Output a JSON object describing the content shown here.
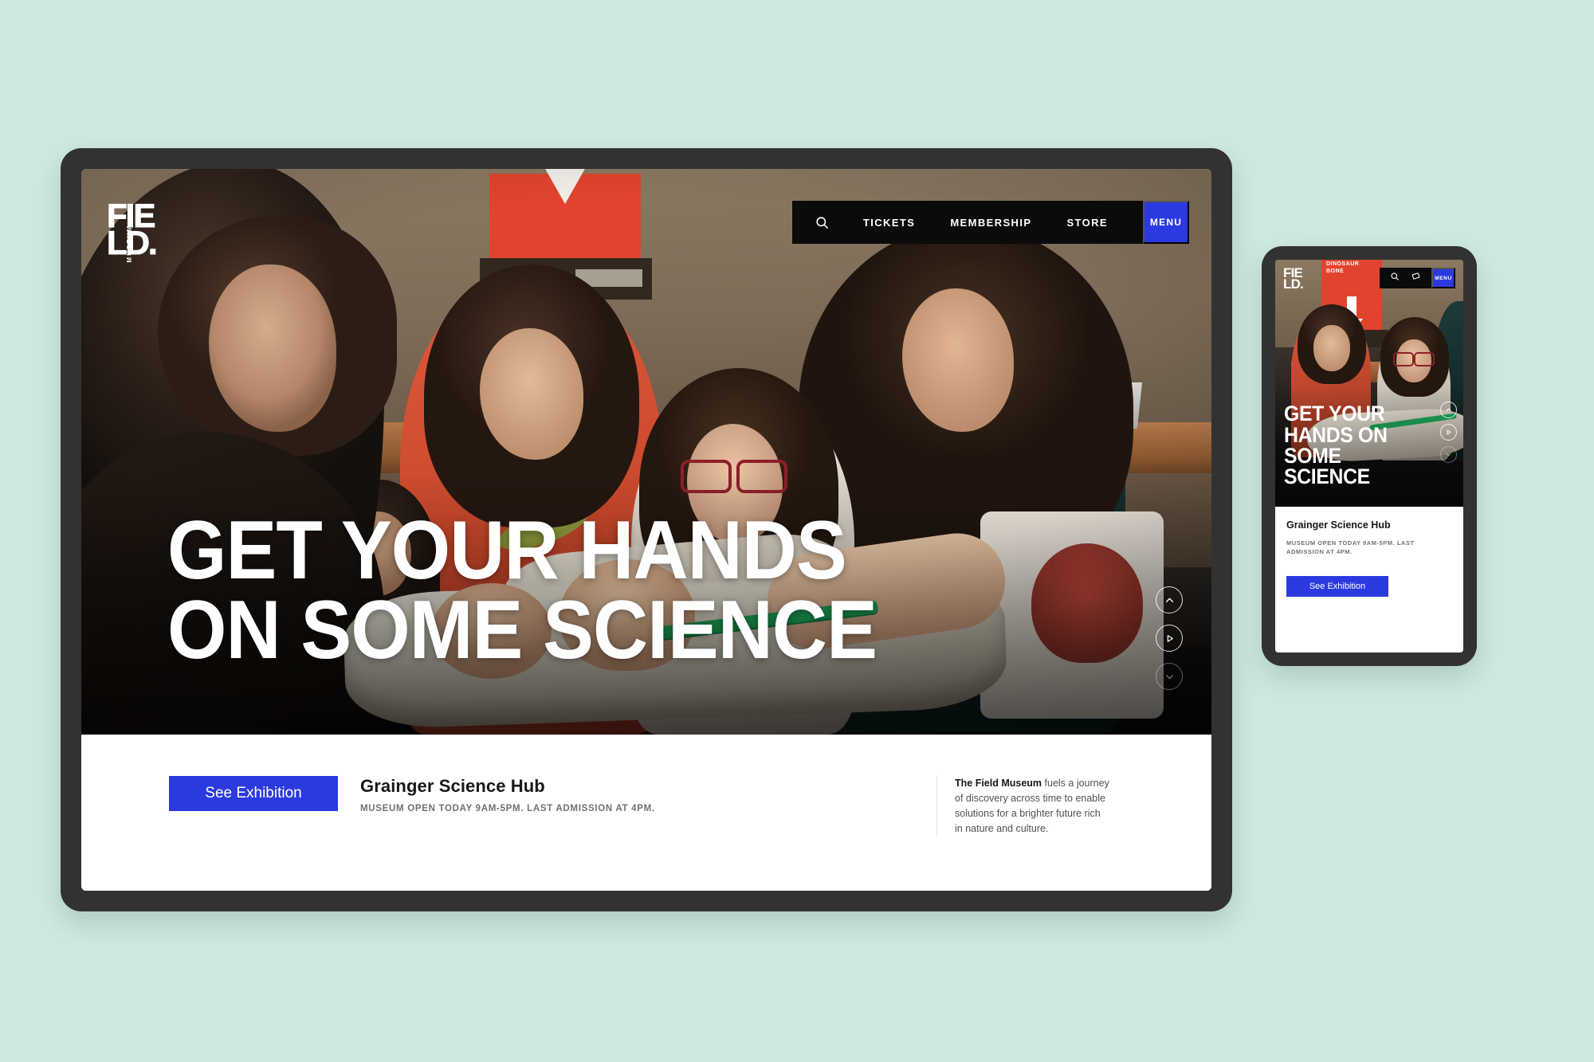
{
  "page": {
    "background_color": "#cfe9df",
    "accent_blue": "#2b3ae0",
    "frame_color": "#323232"
  },
  "brand": {
    "logo_line1": "FIE",
    "logo_line2": "LD.",
    "logo_vertical": "MUSEUM"
  },
  "desktop": {
    "nav": {
      "search_icon": "search-icon",
      "items": [
        {
          "label": "TICKETS"
        },
        {
          "label": "MEMBERSHIP"
        },
        {
          "label": "STORE"
        }
      ],
      "menu_label": "MENU"
    },
    "hero": {
      "headline": "GET YOUR HANDS ON SOME SCIENCE",
      "controls": [
        {
          "name": "chevron-up-icon",
          "state": "active"
        },
        {
          "name": "play-icon",
          "state": "active"
        },
        {
          "name": "chevron-down-icon",
          "state": "dimmed"
        }
      ]
    },
    "info": {
      "cta_label": "See Exhibition",
      "title": "Grainger Science Hub",
      "hours": "MUSEUM OPEN TODAY 9AM-5PM. LAST ADMISSION AT 4PM.",
      "mission_bold": "The Field Museum",
      "mission_rest": " fuels a journey of discovery across time to enable solutions for a brighter future rich in nature and culture."
    }
  },
  "mobile": {
    "nav": {
      "search_icon": "search-icon",
      "ticket_icon": "ticket-icon",
      "menu_label": "MENU"
    },
    "hero": {
      "headline": "GET YOUR HANDS ON SOME SCIENCE",
      "sign_text": "DINOSAUR BONE",
      "controls": [
        {
          "name": "chevron-up-icon",
          "state": "active"
        },
        {
          "name": "play-icon",
          "state": "active"
        },
        {
          "name": "chevron-down-icon",
          "state": "dimmed"
        }
      ]
    },
    "info": {
      "title": "Grainger Science Hub",
      "hours": "MUSEUM OPEN TODAY 9AM-5PM. LAST ADMISSION AT 4PM.",
      "cta_label": "See Exhibition"
    }
  }
}
